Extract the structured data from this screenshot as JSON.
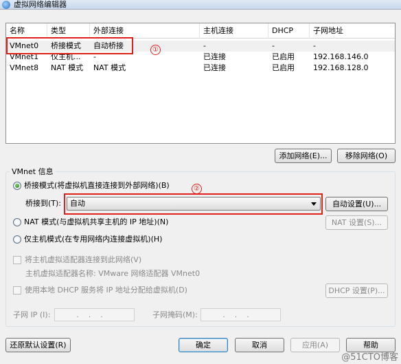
{
  "window": {
    "title": "虚拟网络编辑器"
  },
  "table": {
    "columns": [
      "名称",
      "类型",
      "外部连接",
      "主机连接",
      "DHCP",
      "子网地址"
    ],
    "rows": [
      [
        "VMnet0",
        "桥接模式",
        "自动桥接",
        "-",
        "-",
        "-"
      ],
      [
        "VMnet1",
        "仅主机...",
        "-",
        "已连接",
        "已启用",
        "192.168.146.0"
      ],
      [
        "VMnet8",
        "NAT 模式",
        "NAT 模式",
        "已连接",
        "已启用",
        "192.168.128.0"
      ]
    ]
  },
  "annotations": {
    "one": "①",
    "two": "②"
  },
  "table_buttons": {
    "add": "添加网络(E)...",
    "remove": "移除网络(O)"
  },
  "vmnet_info": {
    "label": "VMnet 信息",
    "bridged": "桥接模式(将虚拟机直接连接到外部网络)(B)",
    "bridge_to_label": "桥接到(T):",
    "bridge_to_value": "自动",
    "auto_settings": "自动设置(U)...",
    "nat": "NAT 模式(与虚拟机共享主机的 IP 地址)(N)",
    "nat_settings": "NAT 设置(S)...",
    "host_only": "仅主机模式(在专用网络内连接虚拟机)(H)",
    "connect_adapter": "将主机虚拟适配器连接到此网络(V)",
    "adapter_name": "主机虚拟适配器名称: VMware 网络适配器 VMnet0",
    "use_dhcp": "使用本地 DHCP 服务将 IP 地址分配给虚拟机(D)",
    "dhcp_settings": "DHCP 设置(P)...",
    "subnet_ip_label": "子网 IP (I):",
    "subnet_ip_value": "...",
    "subnet_mask_label": "子网掩码(M):",
    "subnet_mask_value": "..."
  },
  "footer": {
    "restore": "还原默认设置(R)",
    "ok": "确定",
    "cancel": "取消",
    "apply": "应用(A)",
    "help": "帮助"
  },
  "watermark": "@51CTO博客",
  "colors": {
    "annotation": "#e0201a",
    "selected_row": "#f0f0f0"
  }
}
